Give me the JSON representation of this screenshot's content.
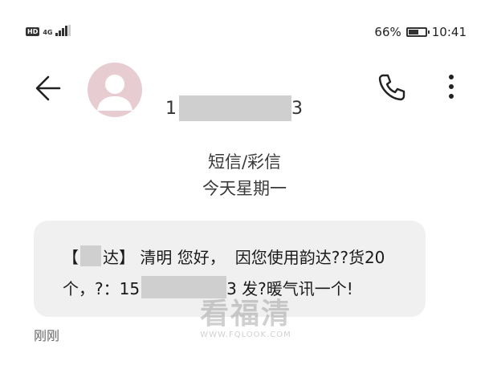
{
  "status_bar": {
    "hd_label": "HD",
    "network_type": "4G",
    "battery_text": "66%",
    "battery_level": 0.66,
    "time": "10:41"
  },
  "header": {
    "back_icon": "arrow-left-icon",
    "avatar_icon": "person-avatar-icon",
    "number_prefix": "1",
    "number_suffix": "3",
    "call_icon": "phone-icon",
    "menu_icon": "more-vertical-icon"
  },
  "conversation": {
    "type_label": "短信/彩信",
    "date_label": "今天星期一"
  },
  "message": {
    "line1_open": "【",
    "line1_part_a": "达】 清明 您好，",
    "line1_part_b": "因您使用韵达??货20",
    "line2_part_a": "个，?：15",
    "line2_part_b": "3 发?暖气讯一个!",
    "time": "刚刚"
  },
  "watermark": {
    "main": "看福清",
    "sub": "WWW.FQLOOK.COM"
  },
  "colors": {
    "avatar_bg": "#e7cdd2",
    "bubble_bg": "#f0f0f0",
    "redaction": "#cfcfcf"
  }
}
